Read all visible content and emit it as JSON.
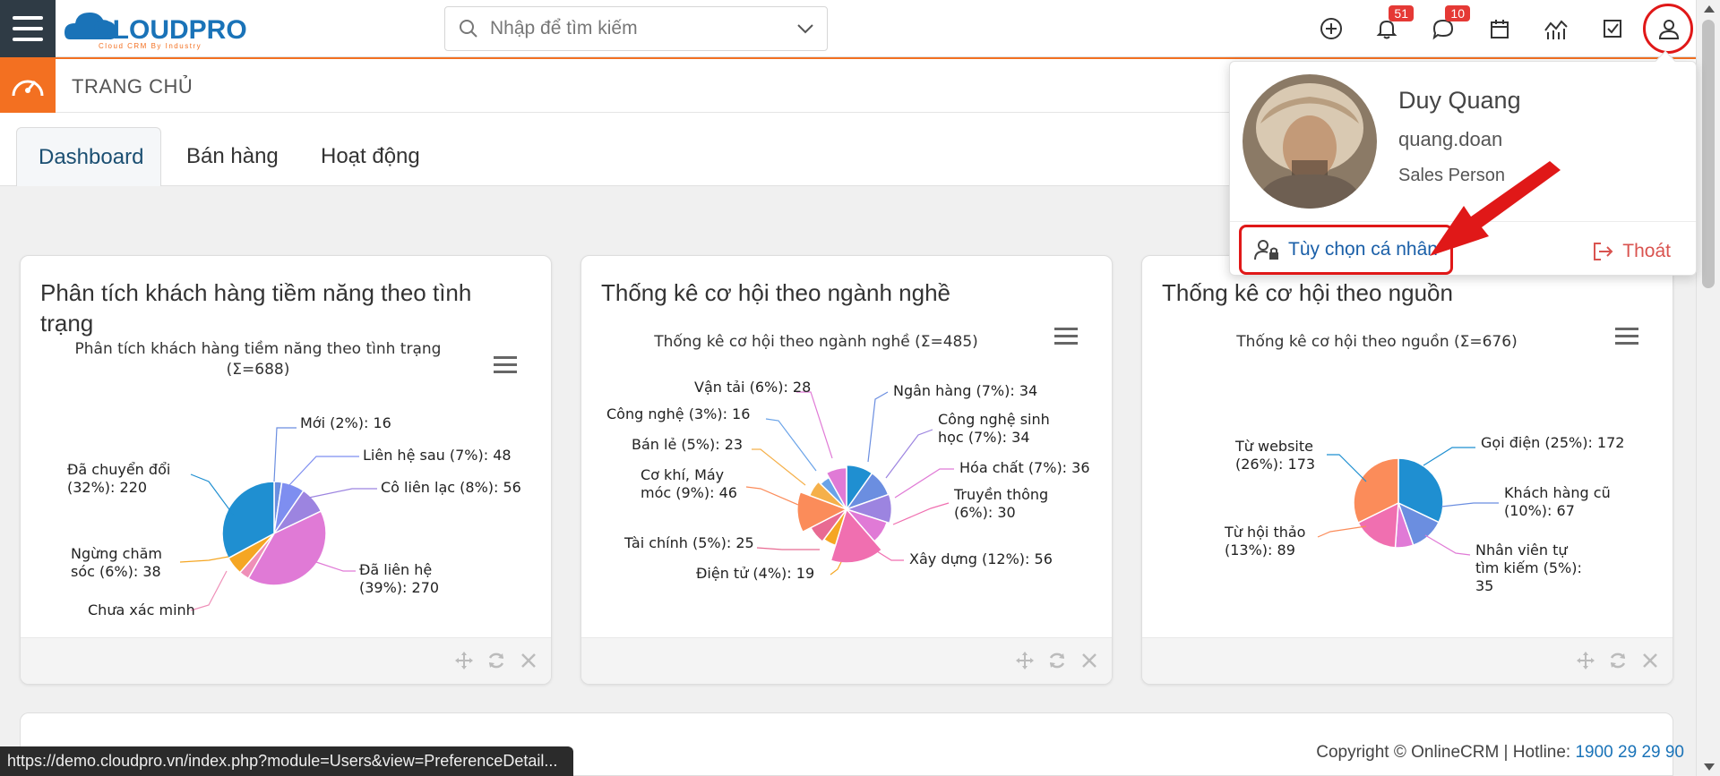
{
  "header": {
    "logo_text": "CLOUDPRO",
    "logo_sub": "Cloud CRM By Industry",
    "search_placeholder": "Nhập để tìm kiếm",
    "notifications_count": "51",
    "messages_count": "10"
  },
  "subheader": {
    "title": "TRANG CHỦ"
  },
  "tabs": [
    {
      "label": "Dashboard",
      "active": true
    },
    {
      "label": "Bán hàng",
      "active": false
    },
    {
      "label": "Hoạt động",
      "active": false
    }
  ],
  "cards": [
    {
      "title": "Phân tích khách hàng tiềm năng theo tình trạng",
      "chart_title_1": "Phân tích khách hàng tiềm năng theo tình trạng",
      "chart_title_2": "(Σ=688)"
    },
    {
      "title": "Thống kê cơ hội theo ngành nghề",
      "chart_title_1": "Thống kê cơ hội theo ngành nghề (Σ=485)"
    },
    {
      "title": "Thống kê cơ hội theo nguồn",
      "chart_title_1": "Thống kê cơ hội theo nguồn (Σ=676)"
    }
  ],
  "chart_data": [
    {
      "type": "pie",
      "title": "Phân tích khách hàng tiềm năng theo tình trạng (Σ=688)",
      "categories": [
        "Mới",
        "Liên hệ sau",
        "Cô liên lạc",
        "Đã liên hệ",
        "Chưa xác minh",
        "Ngừng chăm sóc",
        "Đã chuyển đổi"
      ],
      "values": [
        16,
        48,
        56,
        270,
        21,
        38,
        220
      ],
      "labels": [
        "Mới (2%): 16",
        "Liên hệ sau (7%): 48",
        "Cô liên lạc (8%): 56",
        "Đã liên hệ",
        "(39%): 270",
        "Chưa xác minh",
        "Ngừng chăm",
        "sóc (6%): 38",
        "Đã chuyển đổi",
        "(32%): 220"
      ],
      "colors": [
        "#6b8ee0",
        "#7e8ef0",
        "#9c84e0",
        "#e07ad6",
        "#ef8fb8",
        "#f5a623",
        "#1f8fd1"
      ]
    },
    {
      "type": "pie",
      "title": "Thống kê cơ hội theo ngành nghề (Σ=485)",
      "categories": [
        "Ngân hàng",
        "Công nghệ sinh học",
        "Hóa chất",
        "Truyền thông",
        "Xây dựng",
        "Điện tử",
        "Tài chính",
        "Cơ khí, Máy móc",
        "Bán lẻ",
        "Công nghệ",
        "Vận tải"
      ],
      "values": [
        34,
        34,
        36,
        30,
        56,
        19,
        25,
        46,
        23,
        16,
        28
      ],
      "labels": [
        "Ngân hàng (7%): 34",
        "Công nghệ sinh",
        "học (7%): 34",
        "Hóa chất (7%): 36",
        "Truyền thông",
        "(6%): 30",
        "Xây dựng (12%): 56",
        "Điện tử (4%): 19",
        "Tài chính (5%): 25",
        "Cơ khí, Máy",
        "móc (9%): 46",
        "Bán lẻ (5%): 23",
        "Công nghệ (3%): 16",
        "Vận tải (6%): 28"
      ],
      "colors": [
        "#1f8fd1",
        "#6b8ee0",
        "#9c84e0",
        "#e07ad6",
        "#f06fb0",
        "#f5a623",
        "#e86a92",
        "#fb8c5a",
        "#f5b04a",
        "#6aa3e8",
        "#e07ad6"
      ]
    },
    {
      "type": "pie",
      "title": "Thống kê cơ hội theo nguồn (Σ=676)",
      "categories": [
        "Gọi điện",
        "Khách hàng cũ",
        "Nhân viên tự tìm kiếm",
        "Từ hội thảo",
        "Từ website"
      ],
      "values": [
        172,
        67,
        35,
        89,
        173
      ],
      "labels": [
        "Gọi điện (25%): 172",
        "Khách hàng cũ",
        "(10%): 67",
        "Nhân viên tự",
        "tìm kiếm (5%):",
        "35",
        "Từ hội thảo",
        "(13%): 89",
        "Từ website",
        "(26%): 173"
      ],
      "colors": [
        "#1f8fd1",
        "#6b8ee0",
        "#e07ad6",
        "#f06fb0",
        "#fb8c5a",
        "#f5a623",
        "#9c84e0",
        "#1a73b8"
      ]
    }
  ],
  "popup": {
    "name": "Duy Quang",
    "login": "quang.doan",
    "role": "Sales Person",
    "preferences_label": "Tùy chọn cá nhân",
    "logout_label": "Thoát"
  },
  "status_url": "https://demo.cloudpro.vn/index.php?module=Users&view=PreferenceDetail...",
  "footer": {
    "copyright": "Copyright © OnlineCRM | Hotline: ",
    "hotline": "1900 29 29 90"
  }
}
